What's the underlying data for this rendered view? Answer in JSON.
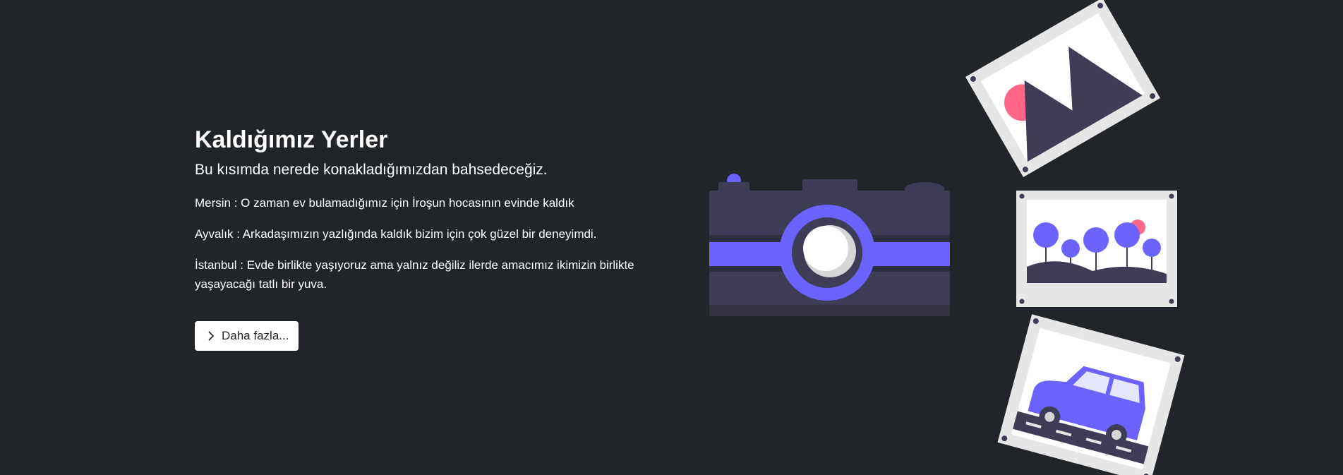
{
  "section": {
    "title": "Kaldığımız Yerler",
    "lead": "Bu kısımda nerede konakladığımızdan bahsedeceğiz.",
    "paragraphs": [
      "Mersin : O zaman ev bulamadığımız için İroşun hocasının evinde kaldık",
      "Ayvalık : Arkadaşımızın yazlığında kaldık bizim için çok güzel bir deneyimdi.",
      "İstanbul : Evde birlikte yaşıyoruz ama yalnız değiliz ilerde amacımız ikimizin birlikte yaşayacağı tatlı bir yuva."
    ],
    "button_label": "Daha fazla..."
  },
  "illustration": {
    "icons": [
      "camera-icon",
      "mountain-photo-icon",
      "trees-photo-icon",
      "car-photo-icon",
      "chevron-right-icon"
    ],
    "colors": {
      "background": "#212529",
      "accent": "#6c63ff",
      "dark": "#3f3d56",
      "pink": "#ff6584",
      "frame": "#e6e6e6"
    }
  }
}
